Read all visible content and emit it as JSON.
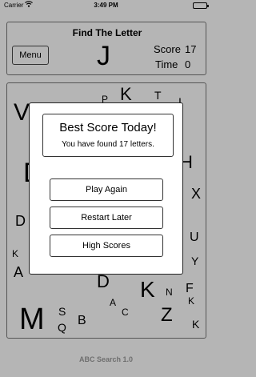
{
  "status_bar": {
    "carrier": "Carrier",
    "time": "3:49 PM",
    "wifi_icon": "wifi-icon",
    "battery_icon": "battery-icon"
  },
  "header": {
    "title": "Find The Letter",
    "menu_label": "Menu",
    "target_letter": "J",
    "score_label": "Score",
    "score_value": "17",
    "time_label": "Time",
    "time_value": "0"
  },
  "board": {
    "letters": [
      "V",
      "P",
      "K",
      "T",
      "I",
      "D",
      "H",
      "X",
      "D",
      "U",
      "K",
      "Y",
      "A",
      "D",
      "K",
      "N",
      "F",
      "A",
      "Z",
      "K",
      "M",
      "S",
      "Q",
      "B",
      "C",
      "K"
    ]
  },
  "dialog": {
    "title": "Best Score Today!",
    "message": "You have found 17 letters.",
    "buttons": [
      "Play Again",
      "Restart Later",
      "High Scores"
    ]
  },
  "footer": {
    "app_version": "ABC Search 1.0"
  }
}
